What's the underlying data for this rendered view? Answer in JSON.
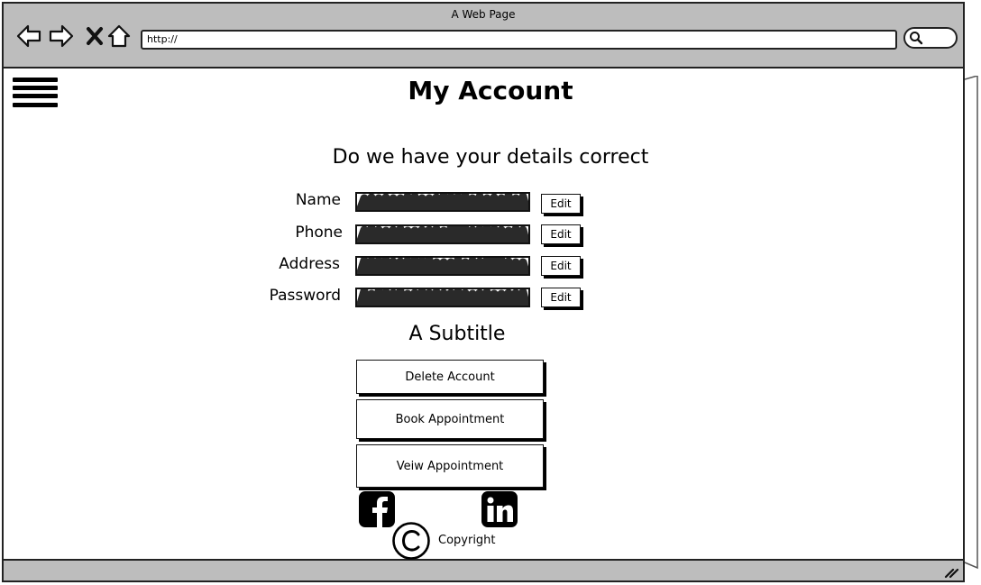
{
  "window": {
    "title": "A Web Page",
    "url": "http://"
  },
  "page": {
    "title": "My Account",
    "question": "Do we have your details correct",
    "fields": [
      {
        "label": "Name",
        "edit_label": "Edit"
      },
      {
        "label": "Phone",
        "edit_label": "Edit"
      },
      {
        "label": "Address",
        "edit_label": "Edit"
      },
      {
        "label": "Password",
        "edit_label": "Edit"
      }
    ],
    "subtitle": "A Subtitle",
    "actions": [
      {
        "label": "Delete Account"
      },
      {
        "label": "Book Appointment"
      },
      {
        "label": "Veiw Appointment"
      }
    ]
  },
  "footer": {
    "copyright": "Copyright"
  },
  "icons": {
    "back": "back-arrow-icon",
    "forward": "forward-arrow-icon",
    "stop": "close-icon",
    "home": "home-icon",
    "search": "search-icon",
    "menu": "hamburger-menu-icon",
    "facebook": "facebook-icon",
    "linkedin": "linkedin-icon",
    "copyright": "copyright-icon"
  }
}
